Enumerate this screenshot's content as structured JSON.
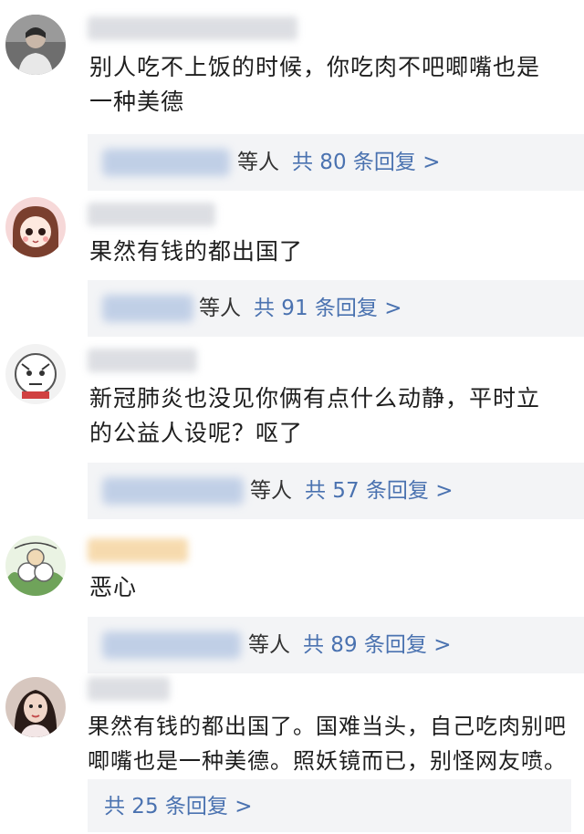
{
  "comments": [
    {
      "text_lines": [
        "别人吃不上饭的时候，你吃肉不吧唧嘴也是",
        "一种美德"
      ],
      "reply_who": "等人",
      "reply_count": "共 80 条回复 >"
    },
    {
      "text_lines": [
        "果然有钱的都出国了"
      ],
      "reply_who": "等人",
      "reply_count": "共 91 条回复 >"
    },
    {
      "text_lines": [
        "新冠肺炎也没见你俩有点什么动静，平时立",
        "的公益人设呢？呕了"
      ],
      "reply_who": "等人",
      "reply_count": "共 57 条回复 >"
    },
    {
      "text_lines": [
        "恶心"
      ],
      "reply_who": "等人",
      "reply_count": "共 89 条回复 >"
    },
    {
      "text_lines": [
        "果然有钱的都出国了。国难当头，自己吃肉别吧",
        "唧嘴也是一种美德。照妖镜而已，别怪网友喷。"
      ],
      "reply_who": "",
      "reply_count": "共 25 条回复 >"
    }
  ],
  "colors": {
    "link": "#4a72b0",
    "reply_bg": "#f3f4f6",
    "text": "#1e1e1e"
  }
}
